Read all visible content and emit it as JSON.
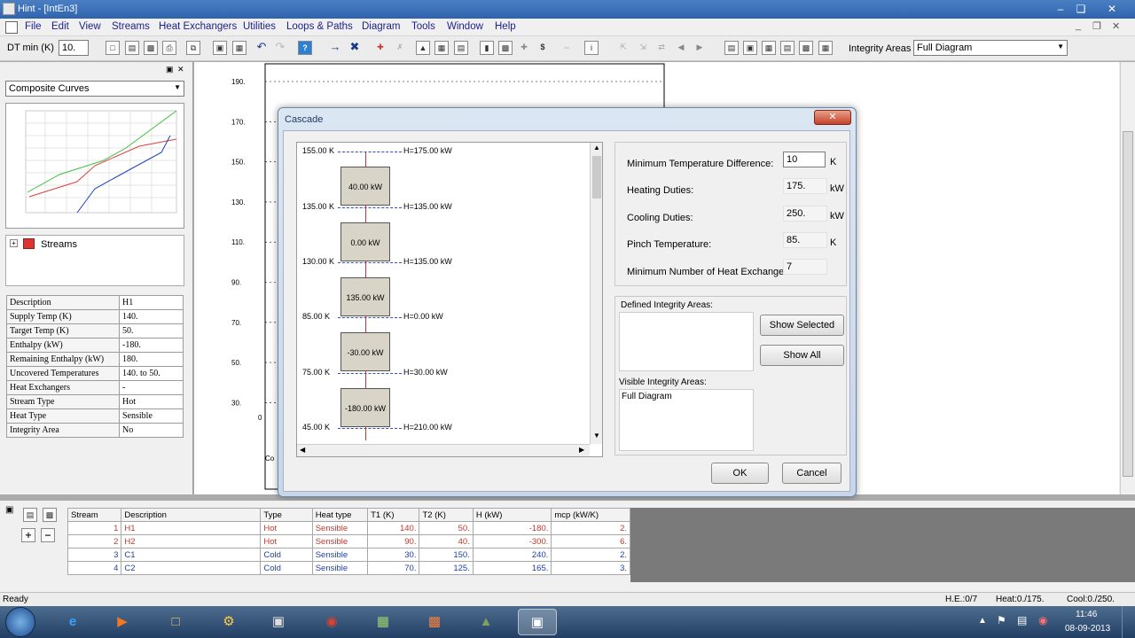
{
  "window": {
    "title": "Hint - [IntEn3]"
  },
  "menu": [
    "File",
    "Edit",
    "View",
    "Streams",
    "Heat Exchangers",
    "Utilities",
    "Loops & Paths",
    "Diagram",
    "Tools",
    "Window",
    "Help"
  ],
  "toolbar": {
    "dt_label": "DT min (K)",
    "dt_value": "10.",
    "integrity_label": "Integrity Areas",
    "integrity_value": "Full Diagram"
  },
  "left": {
    "view_select": "Composite Curves",
    "tree_root": "Streams",
    "props": [
      [
        "Description",
        "H1"
      ],
      [
        "Supply Temp (K)",
        "140."
      ],
      [
        "Target Temp (K)",
        "50."
      ],
      [
        "Enthalpy (kW)",
        "-180."
      ],
      [
        "Remaining Enthalpy (kW)",
        "180."
      ],
      [
        "Uncovered Temperatures",
        "140. to 50."
      ],
      [
        "Heat Exchangers",
        "-"
      ],
      [
        "Stream Type",
        "Hot"
      ],
      [
        "Heat Type",
        "Sensible"
      ],
      [
        "Integrity Area",
        "No"
      ]
    ]
  },
  "bg_chart": {
    "y_ticks": [
      "190.",
      "170.",
      "150.",
      "130.",
      "110.",
      "90.",
      "70.",
      "50.",
      "30."
    ],
    "zero": "0",
    "x_label_partial": "Co"
  },
  "dialog": {
    "title": "Cascade",
    "cascade": [
      {
        "temp": "155.00 K",
        "h": "H=175.00 kW"
      },
      {
        "temp": "135.00 K",
        "h": "H=135.00 kW"
      },
      {
        "temp": "130.00 K",
        "h": "H=135.00 kW"
      },
      {
        "temp": "85.00 K",
        "h": "H=0.00 kW"
      },
      {
        "temp": "75.00 K",
        "h": "H=30.00 kW"
      },
      {
        "temp": "45.00 K",
        "h": "H=210.00 kW"
      }
    ],
    "nodes": [
      "40.00 kW",
      "0.00 kW",
      "135.00 kW",
      "-30.00 kW",
      "-180.00 kW"
    ],
    "min_temp_label": "Minimum Temperature Difference:",
    "min_temp_value": "10",
    "min_temp_unit": "K",
    "heat_label": "Heating Duties:",
    "heat_value": "175.",
    "heat_unit": "kW",
    "cool_label": "Cooling Duties:",
    "cool_value": "250.",
    "cool_unit": "kW",
    "pinch_label": "Pinch Temperature:",
    "pinch_value": "85.",
    "pinch_unit": "K",
    "minhx_label": "Minimum Number of Heat Exchangers:",
    "minhx_value": "7",
    "defined_label": "Defined Integrity Areas:",
    "visible_label": "Visible Integrity Areas:",
    "visible_item": "Full Diagram",
    "show_selected": "Show Selected",
    "show_all": "Show All",
    "ok": "OK",
    "cancel": "Cancel"
  },
  "grid": {
    "headers": [
      "Stream",
      "Description",
      "Type",
      "Heat type",
      "T1 (K)",
      "T2 (K)",
      "H (kW)",
      "mcp (kW/K)"
    ],
    "rows": [
      [
        "1",
        "H1",
        "Hot",
        "Sensible",
        "140.",
        "50.",
        "-180.",
        "2."
      ],
      [
        "2",
        "H2",
        "Hot",
        "Sensible",
        "90.",
        "40.",
        "-300.",
        "6."
      ],
      [
        "3",
        "C1",
        "Cold",
        "Sensible",
        "30.",
        "150.",
        "240.",
        "2."
      ],
      [
        "4",
        "C2",
        "Cold",
        "Sensible",
        "70.",
        "125.",
        "165.",
        "3."
      ]
    ]
  },
  "status": {
    "ready": "Ready",
    "he": "H.E.:0/7",
    "heat": "Heat:0./175.",
    "cool": "Cool:0./250."
  },
  "taskbar": {
    "time": "11:46",
    "date": "08-09-2013"
  },
  "colors": {
    "hot": "#c0392b",
    "cold": "#1f3fa8",
    "dialog_title": "#1e3a5f"
  }
}
